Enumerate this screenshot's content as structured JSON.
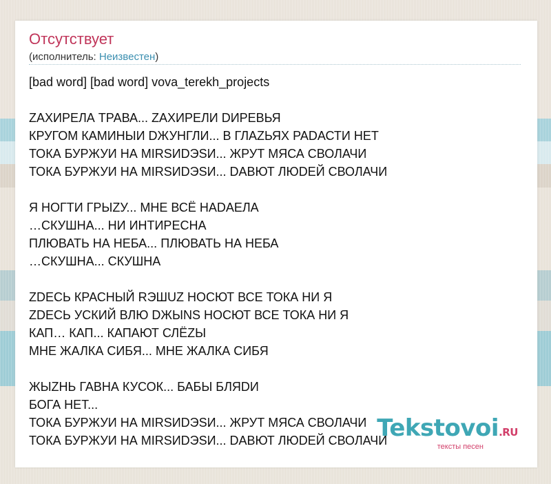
{
  "song": {
    "title": "Отсутствует",
    "artist_prefix": "(исполнитель: ",
    "artist_name": "Неизвестен",
    "artist_suffix": ")"
  },
  "lyrics": {
    "header": "[bad word]  [bad word] vova_terekh_projects",
    "stanzas": [
      [
        "ZАХИРЕЛА ТРАВА... ZАХИРЕЛИ DИРЕВЬЯ",
        "КРУГОМ КАМИНЫИ DЖУНГЛИ... В ГЛАZЬЯХ РАDАСТИ НЕТ",
        "ТОКА БУРЖУИ НА MIRSИDЭSИ... ЖРУТ МЯСА СВОЛАЧИ",
        "ТОКА БУРЖУИ НА MIRSИDЭSИ... DАВЮТ ЛЮDЕЙ СВОЛАЧИ"
      ],
      [
        "Я НОГТИ ГРЫZУ... МНЕ ВСЁ НАDАЕЛА",
        "…СКУШНА... НИ ИНТИРЕСНА",
        "ПЛЮВАТЬ НА НЕБА... ПЛЮВАТЬ НА НЕБА",
        "…СКУШНА... СКУШНА"
      ],
      [
        "ZDЕСЬ КРАСНЫЙ RЭШUZ НОСЮТ ВСЕ ТОКА НИ Я",
        "ZDЕСЬ УСКИЙ ВЛЮ DЖЫNS НОСЮТ ВСЕ ТОКА НИ Я",
        "КАП… КАП... КАПАЮТ СЛЁZЫ",
        "МНЕ ЖАЛКА СИБЯ... МНЕ ЖАЛКА СИБЯ"
      ],
      [
        "ЖЫZНЬ ГАВНА КУСОК... БАБЫ БЛЯDИ",
        "БОГА НЕТ...",
        "ТОКА БУРЖУИ НА MIRSИDЭSИ... ЖРУТ МЯСА СВОЛАЧИ",
        "ТОКА БУРЖУИ НА MIRSИDЭSИ... DАВЮТ ЛЮDЕЙ СВОЛАЧИ"
      ]
    ]
  },
  "logo": {
    "name": "Tekstovoi",
    "tld": ".RU",
    "tagline": "тексты песен"
  },
  "colors": {
    "title": "#c0355a",
    "link": "#3b8fb0",
    "logo_primary": "#3fa7b5",
    "logo_accent": "#d23f6a"
  }
}
